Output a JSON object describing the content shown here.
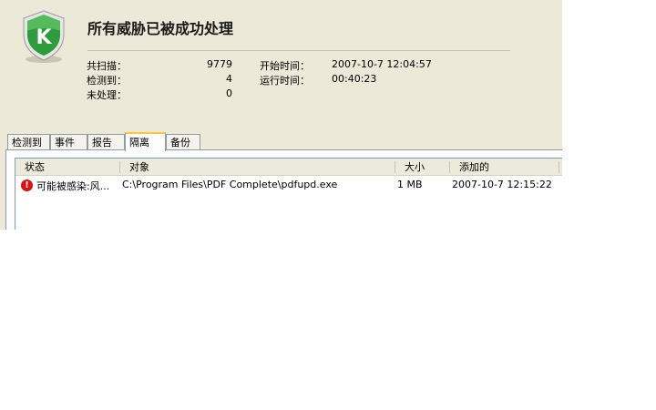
{
  "header": {
    "title": "所有威胁已被成功处理"
  },
  "stats": {
    "scanned_label": "共扫描：",
    "scanned_value": "9779",
    "detected_label": "检测到：",
    "detected_value": "4",
    "unprocessed_label": "未处理：",
    "unprocessed_value": "0",
    "start_label": "开始时间：",
    "start_value": "2007-10-7 12:04:57",
    "runtime_label": "运行时间：",
    "runtime_value": "00:40:23"
  },
  "tabs": [
    {
      "label": "检测到"
    },
    {
      "label": "事件"
    },
    {
      "label": "报告"
    },
    {
      "label": "隔离",
      "active": true
    },
    {
      "label": "备份"
    }
  ],
  "table": {
    "columns": [
      "状态",
      "对象",
      "大小",
      "添加的"
    ],
    "rows": [
      {
        "status": "可能被感染:风...",
        "object": "C:\\Program Files\\PDF Complete\\pdfupd.exe",
        "size": "1 MB",
        "added": "2007-10-7 12:15:22"
      }
    ]
  },
  "colors": {
    "window_bg": "#ece9d8",
    "logo_green": "#2e9b3c",
    "tab_accent": "#ffc83c",
    "warn_red": "#dd1111"
  }
}
